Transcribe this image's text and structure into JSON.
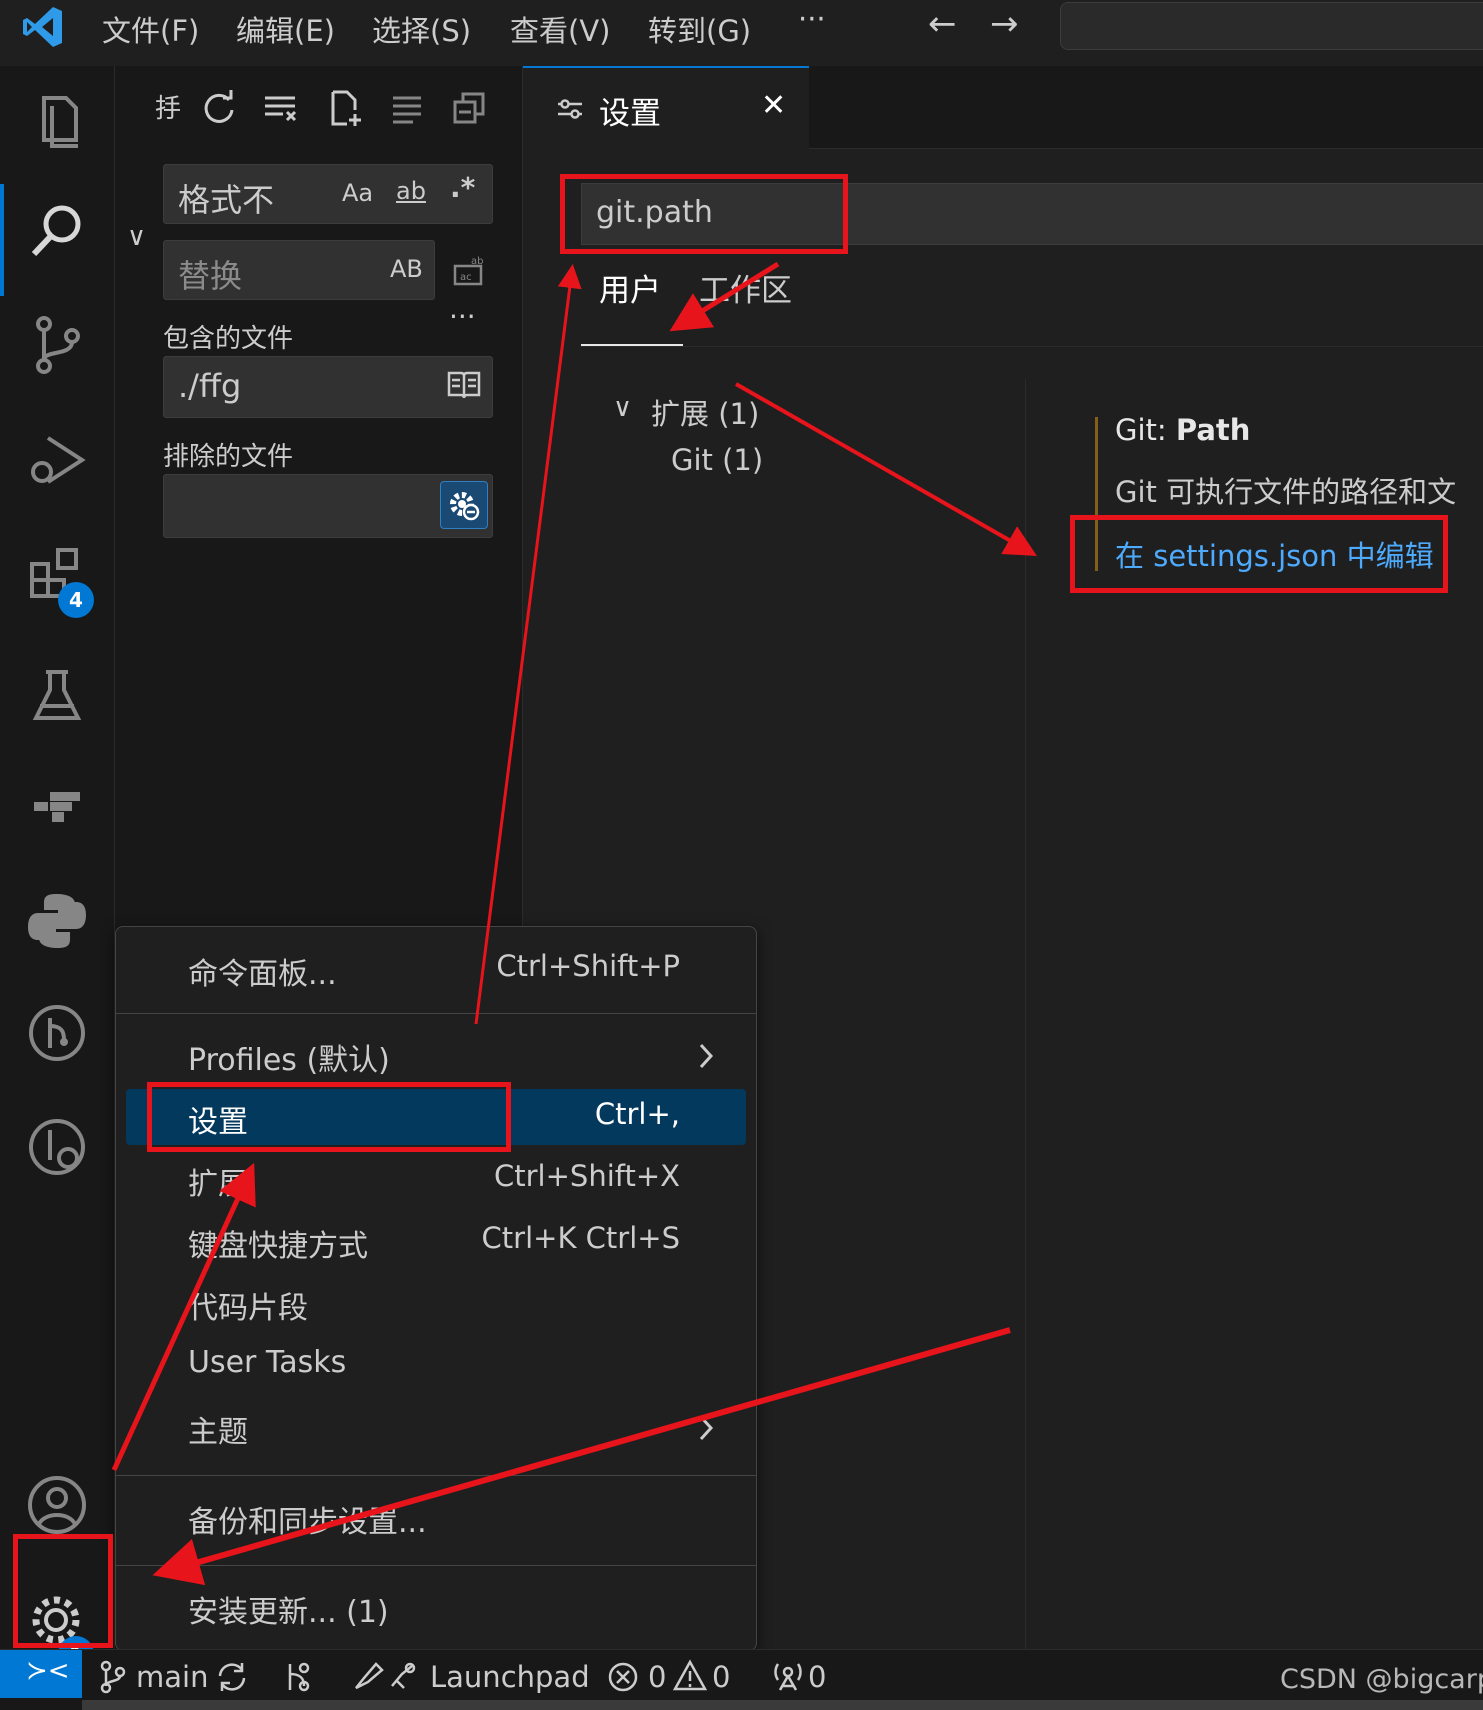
{
  "menubar": {
    "items": [
      "文件(F)",
      "编辑(E)",
      "选择(S)",
      "查看(V)",
      "转到(G)"
    ],
    "more": "···",
    "back": "←",
    "forward": "→"
  },
  "activity": {
    "extensions_badge": "4",
    "settings_badge": "1"
  },
  "search_panel": {
    "search_value": "格式不",
    "match_case": "Aa",
    "whole_word": "ab",
    "regex": ".*",
    "replace_placeholder": "替换",
    "preserve_case": "AB",
    "include_label": "包含的文件",
    "include_value": "./ffg",
    "exclude_label": "排除的文件",
    "more": "···",
    "collapse_chevron": "∨"
  },
  "editor": {
    "tab_title": "设置",
    "tab_close": "✕",
    "settings_search": "git.path",
    "scope_tabs": [
      "用户",
      "工作区"
    ],
    "toc": {
      "group_label": "扩展 (1)",
      "child_label": "Git (1)"
    },
    "setting": {
      "title_prefix": "Git: ",
      "title_name": "Path",
      "description": "Git 可执行文件的路径和文",
      "link": "在 settings.json 中编辑"
    }
  },
  "context_menu": {
    "items": [
      {
        "label": "命令面板...",
        "key": "Ctrl+Shift+P"
      },
      {
        "label": "Profiles (默认)",
        "key": "",
        "submenu": true
      },
      {
        "label": "设置",
        "key": "Ctrl+,",
        "selected": true
      },
      {
        "label": "扩展",
        "key": "Ctrl+Shift+X"
      },
      {
        "label": "键盘快捷方式",
        "key": "Ctrl+K Ctrl+S"
      },
      {
        "label": "代码片段",
        "key": ""
      },
      {
        "label": "User Tasks",
        "key": ""
      },
      {
        "label": "主题",
        "key": "",
        "submenu": true
      },
      {
        "label": "备份和同步设置...",
        "key": ""
      },
      {
        "label": "安装更新... (1)",
        "key": ""
      }
    ]
  },
  "statusbar": {
    "remote": "≻<",
    "branch": "main",
    "launchpad": "Launchpad",
    "errors": "0",
    "warnings": "0",
    "ports": "0",
    "watermark": "CSDN @bigcarp"
  },
  "colors": {
    "accent": "#0078d4",
    "annotation_red": "#e8141b",
    "link": "#4daafc",
    "selected_menu": "#04395e",
    "background": "#1f1f1f"
  }
}
